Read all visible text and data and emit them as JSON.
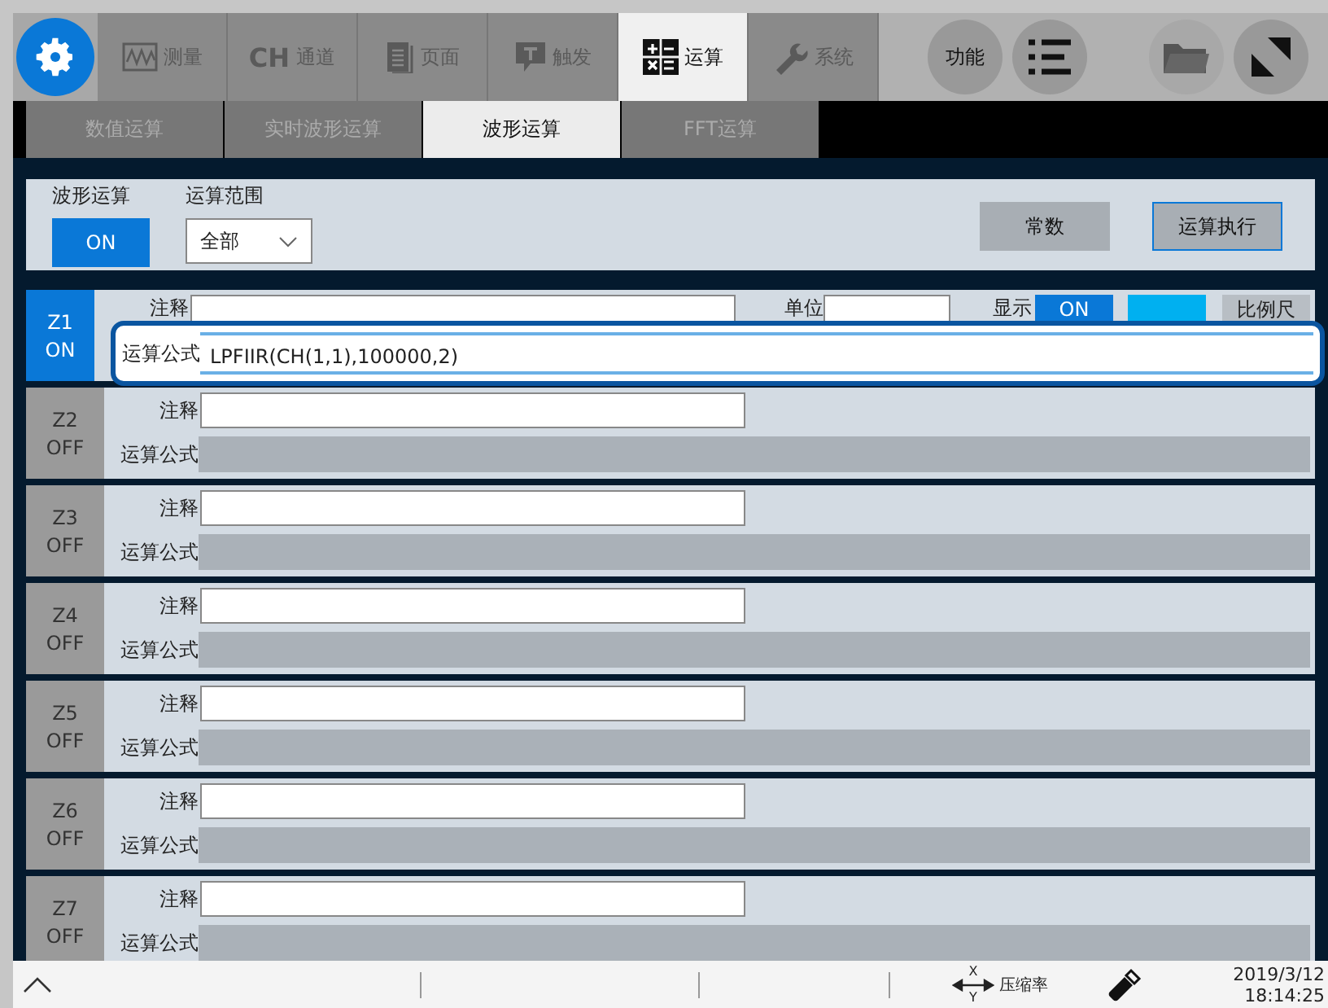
{
  "top_tabs": [
    {
      "kind": "wave",
      "label": "测量",
      "selected": false
    },
    {
      "kind": "ch",
      "prefix": "CH",
      "label": "通道",
      "selected": false
    },
    {
      "kind": "page",
      "label": "页面",
      "selected": false
    },
    {
      "kind": "trigger",
      "label": "触发",
      "selected": false
    },
    {
      "kind": "calc",
      "label": "运算",
      "selected": true
    },
    {
      "kind": "wrench",
      "label": "系统",
      "selected": false
    }
  ],
  "function_button": "功能",
  "sub_tabs": [
    {
      "label": "数值运算",
      "selected": false
    },
    {
      "label": "实时波形运算",
      "selected": false
    },
    {
      "label": "波形运算",
      "selected": true
    },
    {
      "label": "FFT运算",
      "selected": false
    }
  ],
  "panel": {
    "wave_calc_label": "波形运算",
    "wave_calc_button": "ON",
    "range_label": "运算范围",
    "range_value": "全部",
    "constant_button": "常数",
    "execute_button": "运算执行"
  },
  "rows": [
    {
      "name": "Z1",
      "state": "ON",
      "selected": true,
      "comment_label": "注释",
      "formula_label": "运算公式",
      "formula": "LPFIIR(CH(1,1),100000,2)",
      "unit_label": "单位",
      "display_label": "显示",
      "display_button": "ON",
      "scale_button": "比例尺"
    },
    {
      "name": "Z2",
      "state": "OFF",
      "selected": false,
      "comment_label": "注释",
      "formula_label": "运算公式",
      "formula": ""
    },
    {
      "name": "Z3",
      "state": "OFF",
      "selected": false,
      "comment_label": "注释",
      "formula_label": "运算公式",
      "formula": ""
    },
    {
      "name": "Z4",
      "state": "OFF",
      "selected": false,
      "comment_label": "注释",
      "formula_label": "运算公式",
      "formula": ""
    },
    {
      "name": "Z5",
      "state": "OFF",
      "selected": false,
      "comment_label": "注释",
      "formula_label": "运算公式",
      "formula": ""
    },
    {
      "name": "Z6",
      "state": "OFF",
      "selected": false,
      "comment_label": "注释",
      "formula_label": "运算公式",
      "formula": ""
    },
    {
      "name": "Z7",
      "state": "OFF",
      "selected": false,
      "comment_label": "注释",
      "formula_label": "运算公式",
      "formula": ""
    }
  ],
  "status_bar": {
    "axis_x": "X",
    "axis_y": "Y",
    "compress_label": "压缩率",
    "date": "2019/3/12",
    "time": "18:14:25"
  }
}
